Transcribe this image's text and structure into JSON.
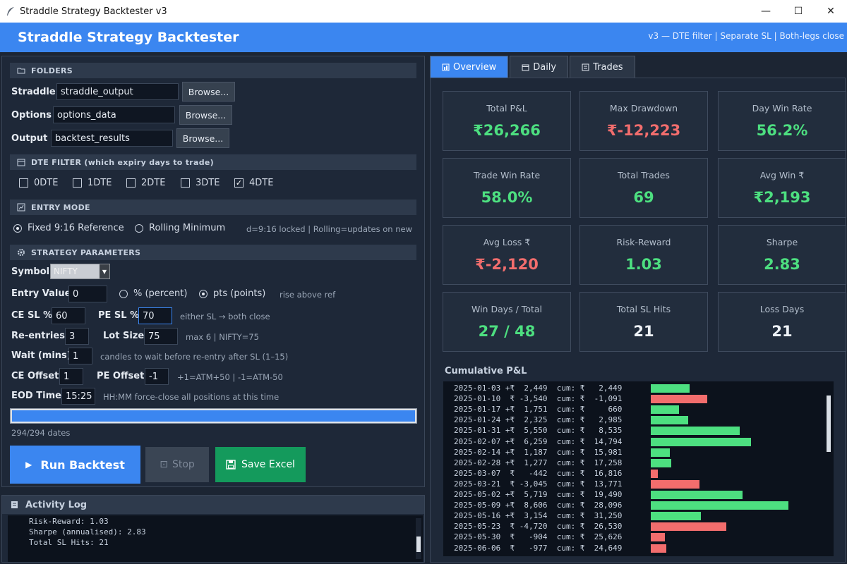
{
  "window": {
    "title": "Straddle Strategy Backtester v3",
    "minimize": "—",
    "maximize": "☐",
    "close": "✕"
  },
  "header": {
    "title": "Straddle Strategy Backtester",
    "subtitle": "v3 — DTE filter | Separate SL | Both-legs close"
  },
  "folders": {
    "section": "FOLDERS",
    "rows": [
      {
        "label": "Straddle",
        "value": "straddle_output",
        "button": "Browse..."
      },
      {
        "label": "Options",
        "value": "options_data",
        "button": "Browse..."
      },
      {
        "label": "Output",
        "value": "backtest_results",
        "button": "Browse..."
      }
    ]
  },
  "dte": {
    "section": "DTE FILTER  (which expiry days to trade)",
    "options": [
      {
        "label": "0DTE",
        "checked": false
      },
      {
        "label": "1DTE",
        "checked": false
      },
      {
        "label": "2DTE",
        "checked": false
      },
      {
        "label": "3DTE",
        "checked": false
      },
      {
        "label": "4DTE",
        "checked": true
      }
    ]
  },
  "entry_mode": {
    "section": "ENTRY MODE",
    "fixed": "Fixed 9:16 Reference",
    "rolling": "Rolling Minimum",
    "selected": "fixed",
    "hint": "d=9:16 locked  |  Rolling=updates on new"
  },
  "params": {
    "section": "STRATEGY PARAMETERS",
    "symbol_label": "Symbol",
    "symbol_value": "NIFTY",
    "entry_value_label": "Entry Value",
    "entry_value": "0",
    "percent_label": "% (percent)",
    "points_label": "pts (points)",
    "entry_unit": "points",
    "entry_hint": "rise above ref",
    "ce_sl_label": "CE SL %",
    "ce_sl": "60",
    "pe_sl_label": "PE SL %",
    "pe_sl": "70",
    "sl_hint": "either SL → both close",
    "reentries_label": "Re-entries",
    "reentries": "3",
    "lot_label": "Lot Size",
    "lot": "75",
    "lot_hint": "max 6  |  NIFTY=75",
    "wait_label": "Wait (mins)",
    "wait": "1",
    "wait_hint": "candles to wait before re-entry after SL  (1–15)",
    "ce_offset_label": "CE Offset",
    "ce_offset": "1",
    "pe_offset_label": "PE Offset",
    "pe_offset": "-1",
    "offset_hint": "+1=ATM+50  |  -1=ATM-50",
    "eod_label": "EOD Time",
    "eod": "15:25",
    "eod_hint": "HH:MM  force-close all positions at this time"
  },
  "progress": {
    "fraction": 1.0,
    "text": "294/294 dates"
  },
  "actions": {
    "run": "Run Backtest",
    "stop": "Stop",
    "save": "Save Excel"
  },
  "log": {
    "title": "Activity Log",
    "lines": [
      "Risk-Reward: 1.03",
      "Sharpe (annualised): 2.83",
      "Total SL Hits: 21"
    ]
  },
  "tabs": [
    {
      "label": "Overview",
      "active": true
    },
    {
      "label": "Daily",
      "active": false
    },
    {
      "label": "Trades",
      "active": false
    }
  ],
  "stats": [
    {
      "label": "Total P&L",
      "value": "₹26,266",
      "color": "green"
    },
    {
      "label": "Max Drawdown",
      "value": "₹-12,223",
      "color": "red"
    },
    {
      "label": "Day Win Rate",
      "value": "56.2%",
      "color": "green"
    },
    {
      "label": "Trade Win Rate",
      "value": "58.0%",
      "color": "green"
    },
    {
      "label": "Total Trades",
      "value": "69",
      "color": "green"
    },
    {
      "label": "Avg Win ₹",
      "value": "₹2,193",
      "color": "green"
    },
    {
      "label": "Avg Loss ₹",
      "value": "₹-2,120",
      "color": "red"
    },
    {
      "label": "Risk-Reward",
      "value": "1.03",
      "color": "green"
    },
    {
      "label": "Sharpe",
      "value": "2.83",
      "color": "green"
    },
    {
      "label": "Win Days / Total",
      "value": "27 / 48",
      "color": "green"
    },
    {
      "label": "Total SL Hits",
      "value": "21",
      "color": "white"
    },
    {
      "label": "Loss Days",
      "value": "21",
      "color": "white"
    }
  ],
  "cumulative": {
    "title": "Cumulative P&L",
    "rows": [
      {
        "date": "2025-01-03",
        "pnl": 2449,
        "cum": 2449
      },
      {
        "date": "2025-01-10",
        "pnl": -3540,
        "cum": -1091
      },
      {
        "date": "2025-01-17",
        "pnl": 1751,
        "cum": 660
      },
      {
        "date": "2025-01-24",
        "pnl": 2325,
        "cum": 2985
      },
      {
        "date": "2025-01-31",
        "pnl": 5550,
        "cum": 8535
      },
      {
        "date": "2025-02-07",
        "pnl": 6259,
        "cum": 14794
      },
      {
        "date": "2025-02-14",
        "pnl": 1187,
        "cum": 15981
      },
      {
        "date": "2025-02-28",
        "pnl": 1277,
        "cum": 17258
      },
      {
        "date": "2025-03-07",
        "pnl": -442,
        "cum": 16816
      },
      {
        "date": "2025-03-21",
        "pnl": -3045,
        "cum": 13771
      },
      {
        "date": "2025-05-02",
        "pnl": 5719,
        "cum": 19490
      },
      {
        "date": "2025-05-09",
        "pnl": 8606,
        "cum": 28096
      },
      {
        "date": "2025-05-16",
        "pnl": 3154,
        "cum": 31250
      },
      {
        "date": "2025-05-23",
        "pnl": -4720,
        "cum": 26530
      },
      {
        "date": "2025-05-30",
        "pnl": -904,
        "cum": 25626
      },
      {
        "date": "2025-06-06",
        "pnl": -977,
        "cum": 24649
      }
    ]
  },
  "colors": {
    "accent": "#3b86f0",
    "positive": "#4ddf80",
    "negative": "#f26d6d",
    "save": "#149a5c"
  }
}
